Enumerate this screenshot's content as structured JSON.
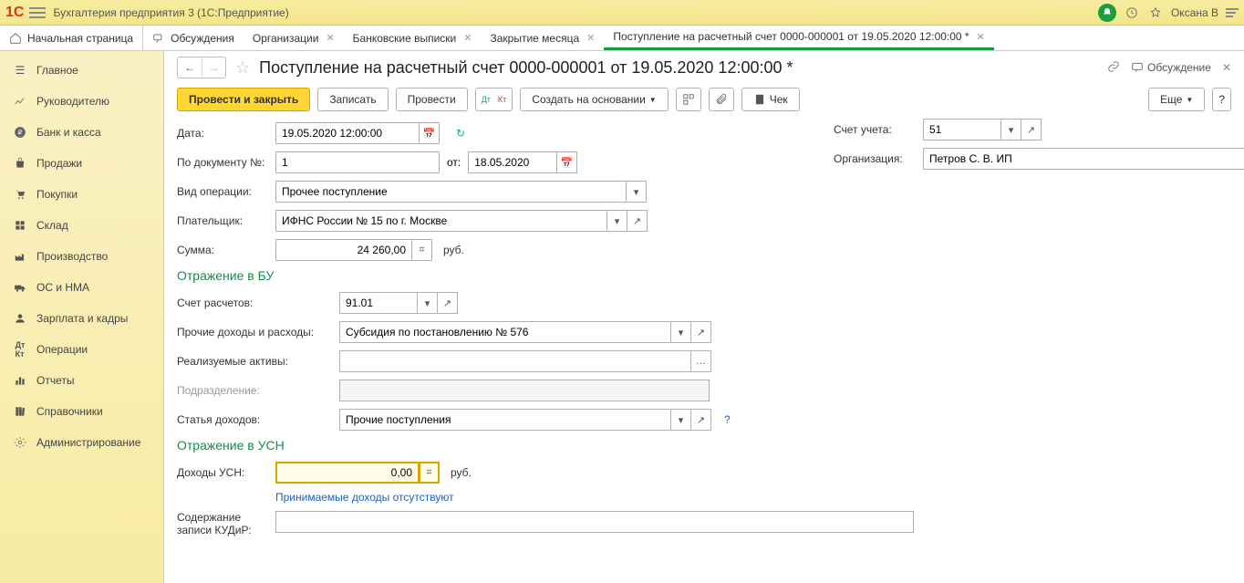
{
  "app": {
    "vendor": "1С",
    "title": "Бухгалтерия предприятия 3  (1С:Предприятие)",
    "user": "Оксана В"
  },
  "tabs": {
    "home": "Начальная страница",
    "items": [
      {
        "label": "Обсуждения"
      },
      {
        "label": "Организации"
      },
      {
        "label": "Банковские выписки"
      },
      {
        "label": "Закрытие месяца"
      },
      {
        "label": "Поступление на расчетный счет 0000-000001 от 19.05.2020 12:00:00 *",
        "active": true
      }
    ]
  },
  "nav": [
    {
      "label": "Главное",
      "icon": "menu"
    },
    {
      "label": "Руководителю",
      "icon": "chart"
    },
    {
      "label": "Банк и касса",
      "icon": "ruble"
    },
    {
      "label": "Продажи",
      "icon": "bag"
    },
    {
      "label": "Покупки",
      "icon": "cart"
    },
    {
      "label": "Склад",
      "icon": "boxes"
    },
    {
      "label": "Производство",
      "icon": "factory"
    },
    {
      "label": "ОС и НМА",
      "icon": "truck"
    },
    {
      "label": "Зарплата и кадры",
      "icon": "person"
    },
    {
      "label": "Операции",
      "icon": "dtkt"
    },
    {
      "label": "Отчеты",
      "icon": "bars"
    },
    {
      "label": "Справочники",
      "icon": "books"
    },
    {
      "label": "Администрирование",
      "icon": "gear"
    }
  ],
  "doc": {
    "title": "Поступление на расчетный счет 0000-000001 от 19.05.2020 12:00:00 *",
    "discuss": "Обсуждение",
    "toolbar": {
      "provesti_zakryt": "Провести и закрыть",
      "zapisat": "Записать",
      "provesti": "Провести",
      "create_based": "Создать на основании",
      "chek": "Чек",
      "more": "Еще"
    },
    "fields": {
      "data_label": "Дата:",
      "data": "19.05.2020 12:00:00",
      "schet_ucheta_label": "Счет учета:",
      "schet_ucheta": "51",
      "po_doc_label": "По документу №:",
      "po_doc": "1",
      "ot_label": "от:",
      "ot": "18.05.2020",
      "org_label": "Организация:",
      "org": "Петров С. В. ИП",
      "vid_label": "Вид операции:",
      "vid": "Прочее поступление",
      "plat_label": "Плательщик:",
      "plat": "ИФНС России № 15 по г. Москве",
      "summa_label": "Сумма:",
      "summa": "24 260,00",
      "rub": "руб.",
      "bu_section": "Отражение в БУ",
      "schet_rasch_label": "Счет расчетов:",
      "schet_rasch": "91.01",
      "prochie_label": "Прочие доходы и расходы:",
      "prochie": "Субсидия по постановлению № 576",
      "realiz_label": "Реализуемые активы:",
      "realiz": "",
      "podrazd_label": "Подразделение:",
      "podrazd": "",
      "statya_label": "Статья доходов:",
      "statya": "Прочие поступления",
      "usn_section": "Отражение в УСН",
      "usn_label": "Доходы УСН:",
      "usn": "0,00",
      "usn_hint": "Принимаемые доходы отсутствуют",
      "kudir_label": "Содержание записи КУДиР:",
      "kudir": ""
    }
  }
}
